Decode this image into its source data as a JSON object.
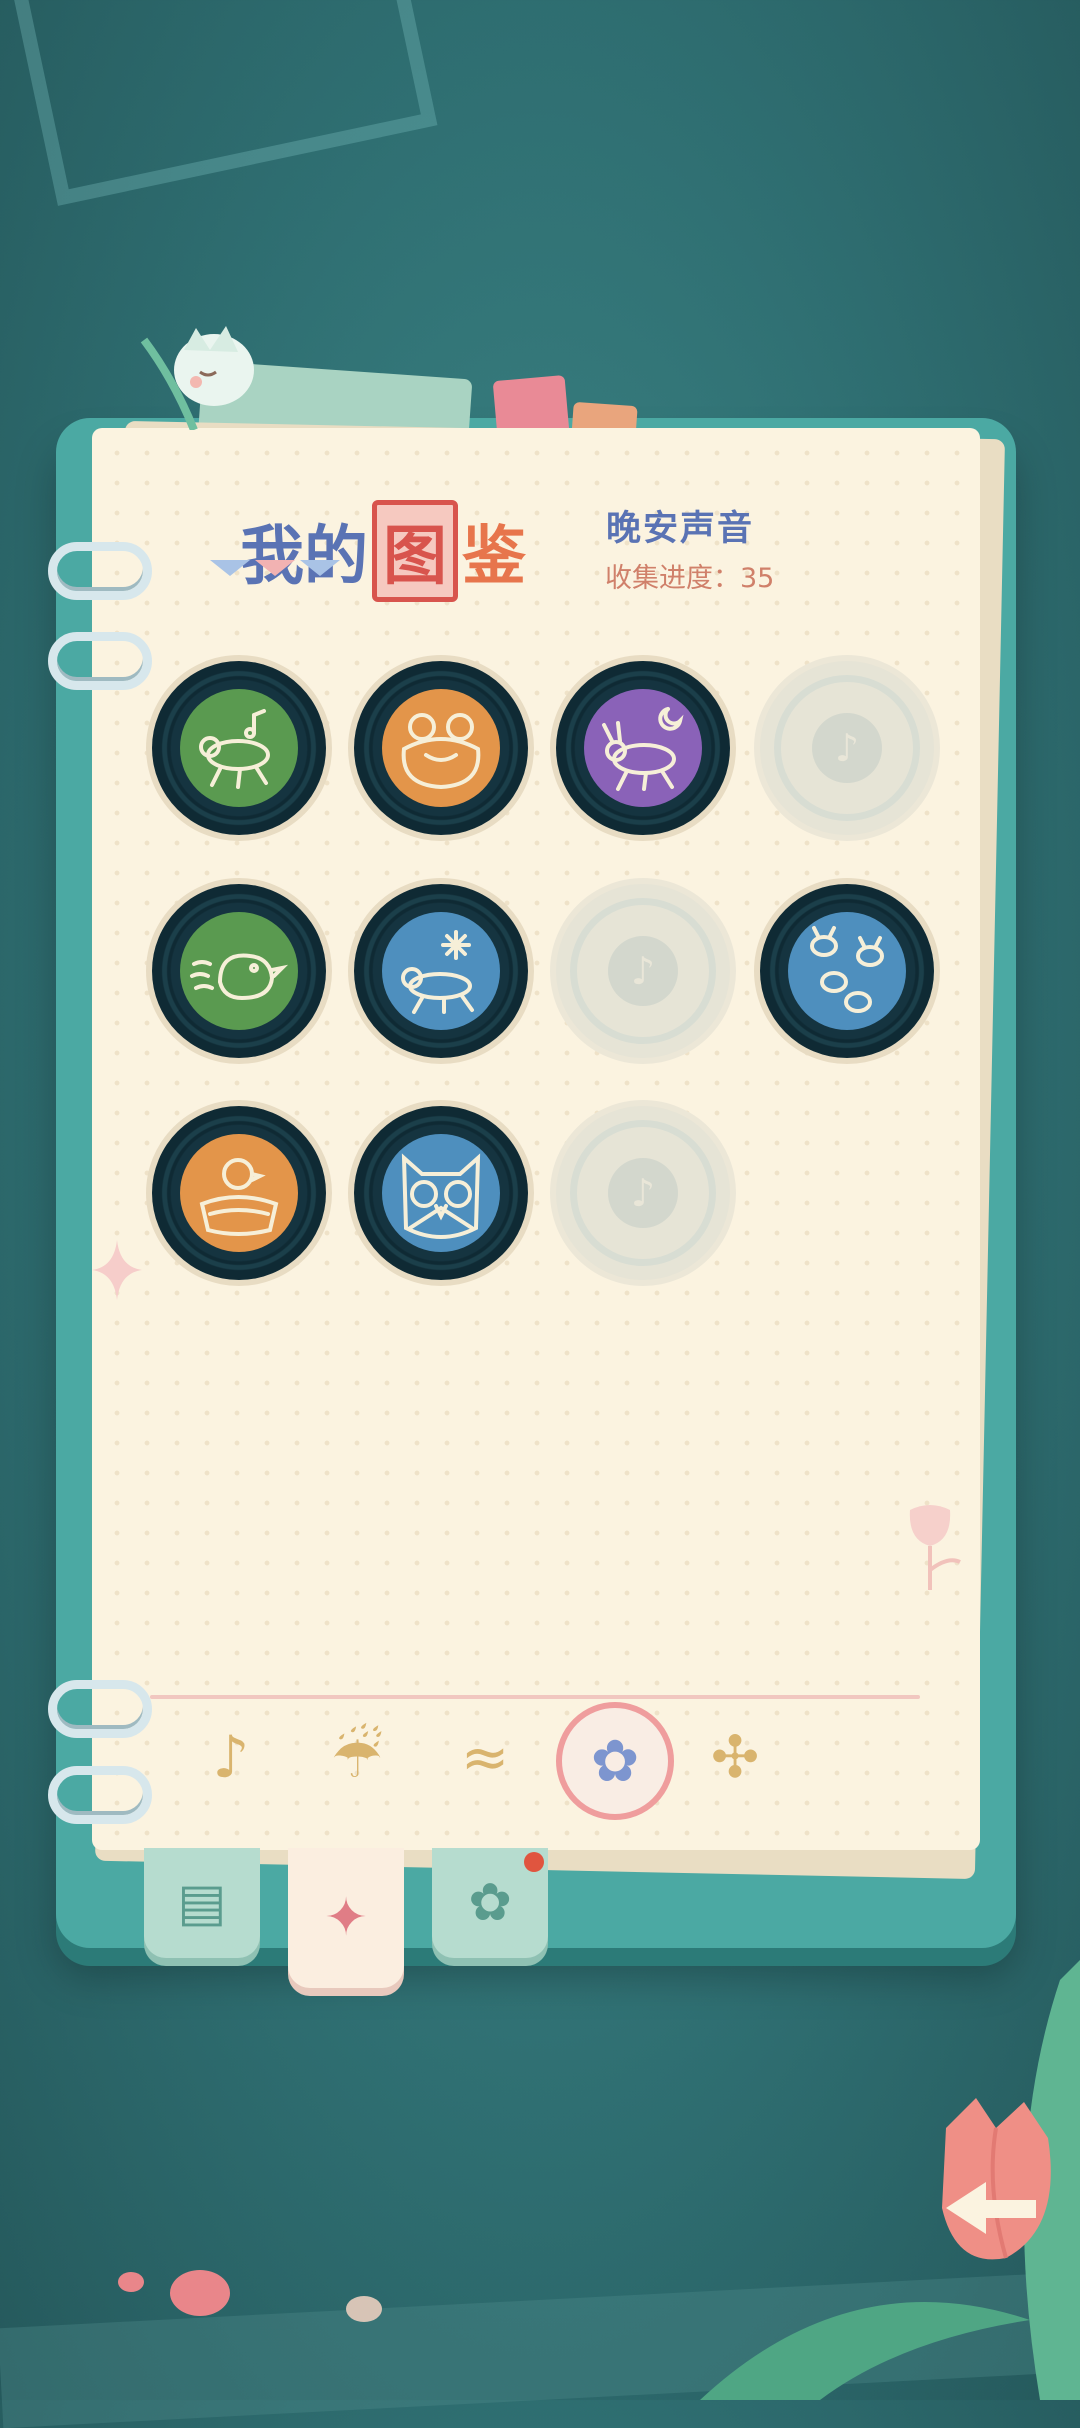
{
  "header": {
    "title_part1": "我的",
    "title_boxed": "图",
    "title_last": "鉴",
    "subtitle": "晚安声音",
    "progress_label": "收集进度：35"
  },
  "records": [
    {
      "state": "owned",
      "label_color": "#5a9a50",
      "icon": "grasshopper-note-icon"
    },
    {
      "state": "owned",
      "label_color": "#e3954a",
      "icon": "frog-icon"
    },
    {
      "state": "owned",
      "label_color": "#8a62b8",
      "icon": "cricket-moon-icon"
    },
    {
      "state": "locked",
      "icon": "locked-note-icon"
    },
    {
      "state": "owned",
      "label_color": "#5a9a50",
      "icon": "bird-icon"
    },
    {
      "state": "owned",
      "label_color": "#4e8fbe",
      "icon": "grasshopper-snow-icon"
    },
    {
      "state": "locked",
      "icon": "locked-note-icon"
    },
    {
      "state": "owned",
      "label_color": "#4e8fbe",
      "icon": "fireflies-icon"
    },
    {
      "state": "owned",
      "label_color": "#e3954a",
      "icon": "chick-nest-icon"
    },
    {
      "state": "owned",
      "label_color": "#4e8fbe",
      "icon": "owl-icon"
    },
    {
      "state": "locked",
      "icon": "locked-note-icon"
    }
  ],
  "categories": [
    {
      "icon": "music-note-icon",
      "glyph": "♪"
    },
    {
      "icon": "rain-cloud-icon",
      "glyph": "☔"
    },
    {
      "icon": "wind-icon",
      "glyph": "≈"
    },
    {
      "icon": "butterfly-icon",
      "glyph": "✿",
      "active": true
    },
    {
      "icon": "leaf-icon",
      "glyph": "✣"
    }
  ],
  "tabs": [
    {
      "icon": "journal-icon",
      "glyph": "▤"
    },
    {
      "icon": "encyclopedia-book-icon",
      "glyph": "✦",
      "active": true
    },
    {
      "icon": "flower-badge-icon",
      "glyph": "✿"
    }
  ],
  "colors": {
    "accent": "#5a73b4",
    "record_dark": "#153440",
    "paper": "#fbf3e0"
  }
}
